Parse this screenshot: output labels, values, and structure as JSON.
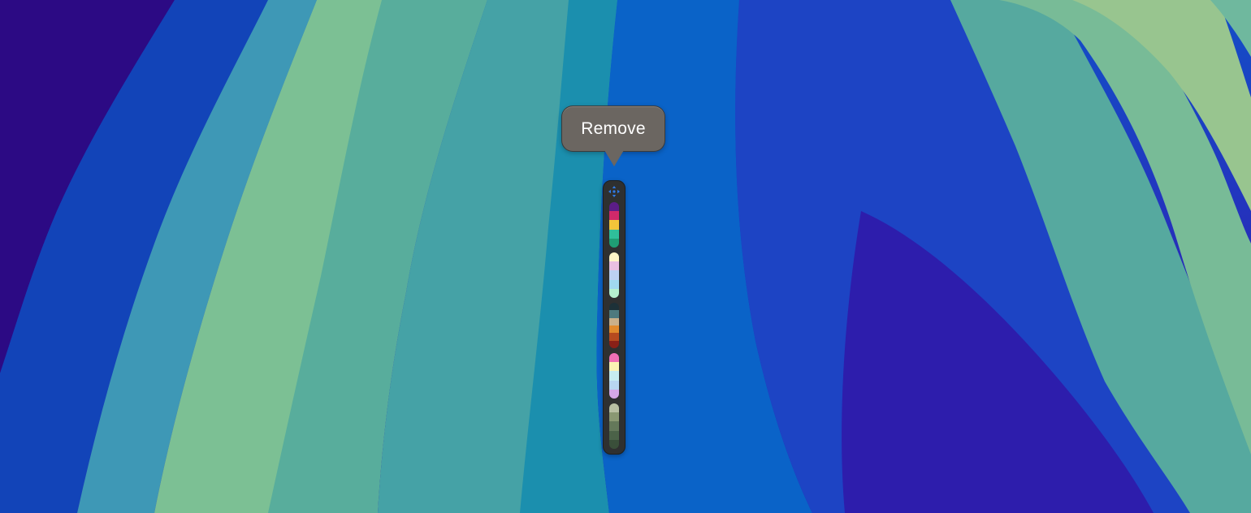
{
  "tooltip": {
    "text": "Remove",
    "background": "#6b6661"
  },
  "toolbar": {
    "background": "#2f3030",
    "move_handle_icon": "move-arrows-icon",
    "move_handle_color": "#2e7be8"
  },
  "palettes": [
    {
      "name": "palette-1",
      "colors": [
        "#5b1d87",
        "#d0296a",
        "#f2c53a",
        "#2fbf9a",
        "#1f9e74"
      ]
    },
    {
      "name": "palette-2",
      "colors": [
        "#fff6c8",
        "#e9bfe2",
        "#bcd1f3",
        "#a0d8f0",
        "#b6f0cf"
      ]
    },
    {
      "name": "palette-3",
      "colors": [
        "#1d3138",
        "#4e7a7e",
        "#c9b08a",
        "#e08a2d",
        "#b64a1f",
        "#8a2017"
      ]
    },
    {
      "name": "palette-4",
      "colors": [
        "#f06fb5",
        "#fbf3b4",
        "#c6edf0",
        "#b8d6f0",
        "#d5a8e7"
      ]
    },
    {
      "name": "palette-5",
      "colors": [
        "#b8bfa3",
        "#8a9873",
        "#64785a",
        "#4b6248",
        "#3a4f3a"
      ]
    }
  ],
  "colors": {
    "wallpaper_deep": "#2e0f86",
    "wallpaper_blue": "#0f5fc8",
    "wallpaper_teal": "#4aa9a3",
    "wallpaper_green": "#8cc79a"
  }
}
